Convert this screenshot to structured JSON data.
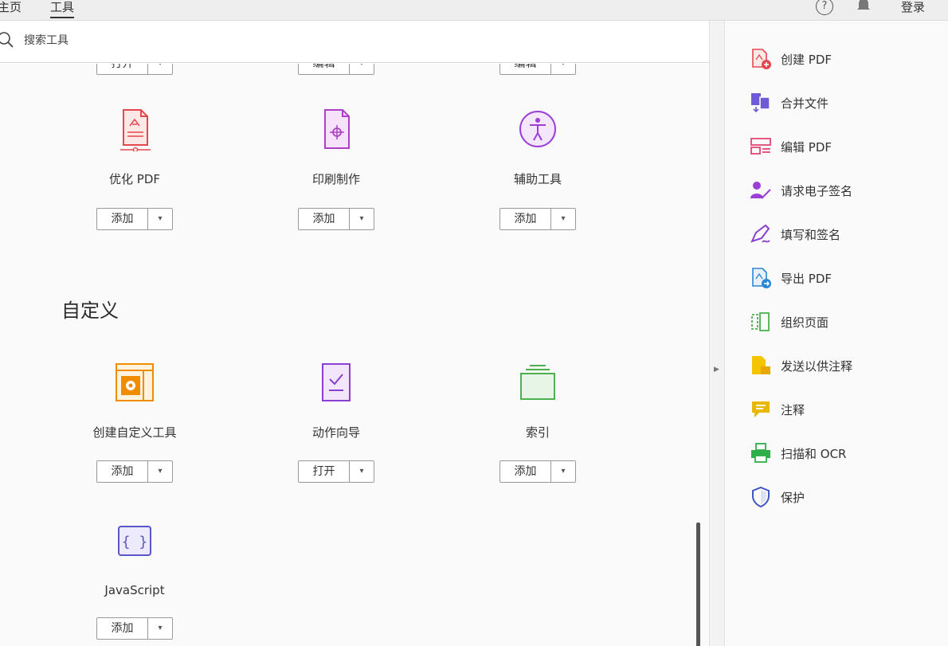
{
  "topbar": {
    "tabs": [
      "主页",
      "工具"
    ],
    "help": "?",
    "login": "登录"
  },
  "search": {
    "placeholder": "搜索工具"
  },
  "partial_buttons": [
    "打开",
    "编辑",
    "编辑"
  ],
  "tools_row1": [
    {
      "label": "优化 PDF",
      "button": "添加"
    },
    {
      "label": "印刷制作",
      "button": "添加"
    },
    {
      "label": "辅助工具",
      "button": "添加"
    }
  ],
  "section_custom": "自定义",
  "tools_row2": [
    {
      "label": "创建自定义工具",
      "button": "添加"
    },
    {
      "label": "动作向导",
      "button": "打开"
    },
    {
      "label": "索引",
      "button": "添加"
    }
  ],
  "tools_row3": [
    {
      "label": "JavaScript",
      "button": "添加"
    }
  ],
  "right_panel": [
    {
      "label": "创建 PDF",
      "icon": "create-pdf-icon",
      "color": "#e34850"
    },
    {
      "label": "合并文件",
      "icon": "combine-files-icon",
      "color": "#6f5ad8"
    },
    {
      "label": "编辑 PDF",
      "icon": "edit-pdf-icon",
      "color": "#e34870"
    },
    {
      "label": "请求电子签名",
      "icon": "request-signature-icon",
      "color": "#9b3fd6"
    },
    {
      "label": "填写和签名",
      "icon": "fill-sign-icon",
      "color": "#8a3fd0"
    },
    {
      "label": "导出 PDF",
      "icon": "export-pdf-icon",
      "color": "#2a86d8"
    },
    {
      "label": "组织页面",
      "icon": "organize-pages-icon",
      "color": "#4caf50"
    },
    {
      "label": "发送以供注释",
      "icon": "send-comment-icon",
      "color": "#e0b800"
    },
    {
      "label": "注释",
      "icon": "comment-icon",
      "color": "#e8b800"
    },
    {
      "label": "扫描和 OCR",
      "icon": "scan-ocr-icon",
      "color": "#2fae4a"
    },
    {
      "label": "保护",
      "icon": "protect-icon",
      "color": "#4055c0"
    }
  ]
}
